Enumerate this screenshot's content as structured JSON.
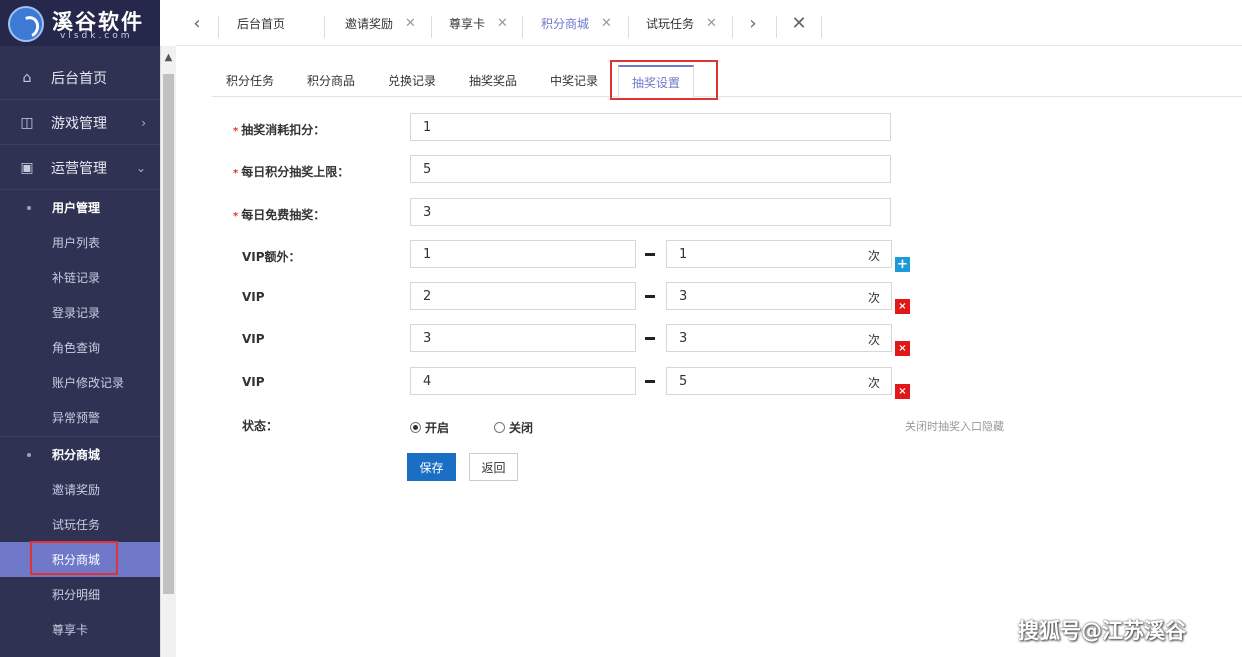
{
  "brand": {
    "name": "溪谷软件",
    "domain": "vlsdk.com"
  },
  "sidebar": {
    "top_items": [
      {
        "label": "后台首页",
        "icon": "home-icon"
      },
      {
        "label": "游戏管理",
        "icon": "gamepad-icon",
        "arrow": "›"
      },
      {
        "label": "运营管理",
        "icon": "chart-icon",
        "arrow": "⌄"
      }
    ],
    "groups": [
      {
        "label": "用户管理",
        "items": [
          "用户列表",
          "补链记录",
          "登录记录",
          "角色查询",
          "账户修改记录",
          "异常预警"
        ]
      },
      {
        "label": "积分商城",
        "items": [
          "邀请奖励",
          "试玩任务",
          "积分商城",
          "积分明细",
          "尊享卡"
        ]
      }
    ],
    "active_item": "积分商城"
  },
  "tabbar": {
    "prev": "‹",
    "next": "›",
    "close_all": "✕",
    "tabs": [
      {
        "label": "后台首页",
        "closable": false
      },
      {
        "label": "邀请奖励",
        "closable": true
      },
      {
        "label": "尊享卡",
        "closable": true
      },
      {
        "label": "积分商城",
        "closable": true,
        "active": true
      },
      {
        "label": "试玩任务",
        "closable": true
      }
    ]
  },
  "subtabs": [
    "积分任务",
    "积分商品",
    "兑换记录",
    "抽奖奖品",
    "中奖记录",
    "抽奖设置"
  ],
  "form": {
    "required_mark": "*",
    "cost": {
      "label": "抽奖消耗扣分：",
      "value": "1"
    },
    "daily_limit": {
      "label": "每日积分抽奖上限：",
      "value": "5"
    },
    "free_daily": {
      "label": "每日免费抽奖：",
      "value": "3"
    },
    "unit": "次",
    "add_icon": "+",
    "delete_icon": "×",
    "vip_rows": [
      {
        "label": "VIP额外：",
        "level": "1",
        "count": "1"
      },
      {
        "label": "VIP",
        "level": "2",
        "count": "3"
      },
      {
        "label": "VIP",
        "level": "3",
        "count": "3"
      },
      {
        "label": "VIP",
        "level": "4",
        "count": "5"
      }
    ],
    "status": {
      "label": "状态：",
      "on": "开启",
      "off": "关闭",
      "selected": "开启",
      "hint": "关闭时抽奖入口隐藏"
    },
    "save_label": "保存",
    "back_label": "返回"
  },
  "watermark": "搜狐号@江苏溪谷"
}
